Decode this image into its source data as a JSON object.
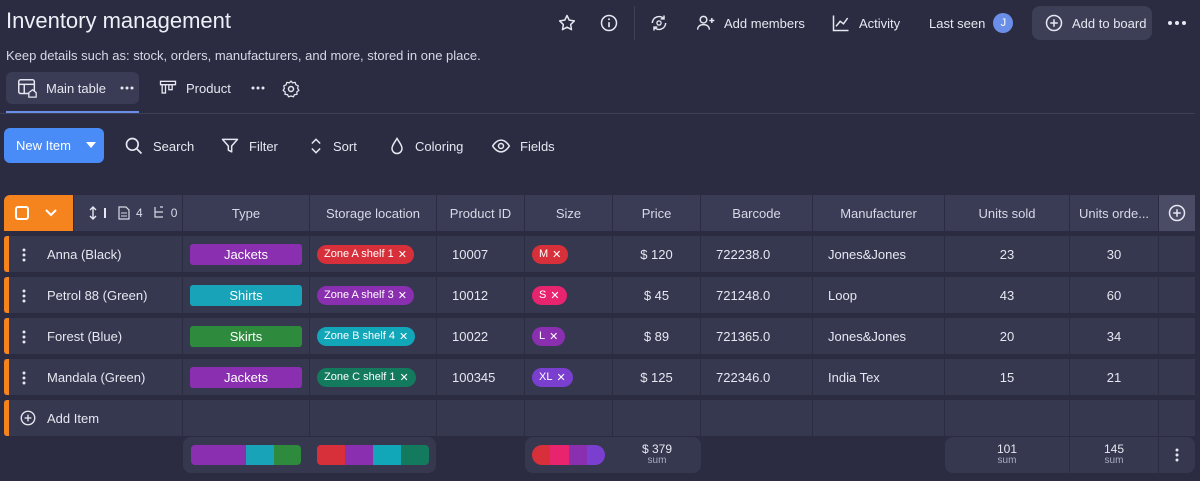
{
  "header": {
    "title": "Inventory management",
    "description": "Keep details such as: stock, orders, manufacturers, and more, stored in one place.",
    "add_members": "Add members",
    "activity": "Activity",
    "last_seen": "Last seen",
    "avatar_initial": "J",
    "add_to_board": "Add to board"
  },
  "tabs": {
    "main_table": "Main table",
    "product": "Product"
  },
  "toolbar": {
    "new_item": "New Item",
    "search": "Search",
    "filter": "Filter",
    "sort": "Sort",
    "coloring": "Coloring",
    "fields": "Fields"
  },
  "table": {
    "counts": {
      "docs": "4",
      "subitems": "0"
    },
    "columns": [
      "Type",
      "Storage location",
      "Product ID",
      "Size",
      "Price",
      "Barcode",
      "Manufacturer",
      "Units sold",
      "Units orde..."
    ],
    "rows": [
      {
        "name": "Anna (Black)",
        "type": "Jackets",
        "location": "Zone A shelf 1",
        "product_id": "10007",
        "size": "M",
        "price": "$ 120",
        "barcode": "722238.0",
        "manufacturer": "Jones&Jones",
        "units_sold": "23",
        "units_ordered": "30"
      },
      {
        "name": "Petrol 88 (Green)",
        "type": "Shirts",
        "location": "Zone A shelf 3",
        "product_id": "10012",
        "size": "S",
        "price": "$ 45",
        "barcode": "721248.0",
        "manufacturer": "Loop",
        "units_sold": "43",
        "units_ordered": "60"
      },
      {
        "name": "Forest (Blue)",
        "type": "Skirts",
        "location": "Zone B shelf 4",
        "product_id": "10022",
        "size": "L",
        "price": "$ 89",
        "barcode": "721365.0",
        "manufacturer": "Jones&Jones",
        "units_sold": "20",
        "units_ordered": "34"
      },
      {
        "name": "Mandala (Green)",
        "type": "Jackets",
        "location": "Zone C shelf 1",
        "product_id": "100345",
        "size": "XL",
        "price": "$ 125",
        "barcode": "722346.0",
        "manufacturer": "India Tex",
        "units_sold": "15",
        "units_ordered": "21"
      }
    ],
    "add_item": "Add Item",
    "summary": {
      "price_sum": "$ 379",
      "units_sold_sum": "101",
      "units_ordered_sum": "145",
      "sum_label": "sum"
    }
  },
  "colors": {
    "accent": "#4a8cf7",
    "group": "#f5841f",
    "type_jackets": "#8a2fb0",
    "type_shirts": "#18a3b8",
    "type_skirts": "#2e8b3e",
    "zone_a1": "#d8303a",
    "zone_a3": "#8a2fb0",
    "zone_b4": "#12a6b9",
    "zone_c1": "#137a5e",
    "size_m": "#d8303a",
    "size_s": "#e8246f",
    "size_l": "#8a2fb0",
    "size_xl": "#7b3fd0"
  }
}
